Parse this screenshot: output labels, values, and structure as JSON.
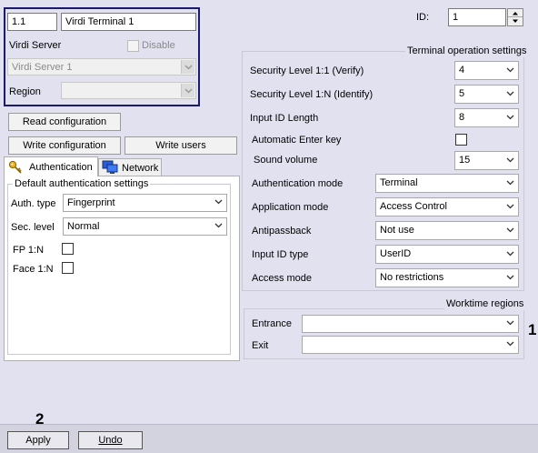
{
  "server_panel": {
    "terminal_id": "1.1",
    "terminal_name": "Virdi Terminal 1",
    "server_label": "Virdi Server",
    "disable_label": "Disable",
    "server_value": "Virdi Server 1",
    "region_label": "Region",
    "region_value": ""
  },
  "buttons": {
    "read_config": "Read configuration",
    "write_config": "Write configuration",
    "write_users": "Write users",
    "apply": "Apply",
    "undo": "Undo"
  },
  "tabs": [
    {
      "label": "Authentication",
      "icon": "key-icon",
      "active": true
    },
    {
      "label": "Network",
      "icon": "network-icon",
      "active": false
    }
  ],
  "auth_settings": {
    "group_title": "Default authentication settings",
    "auth_type_label": "Auth. type",
    "auth_type_value": "Fingerprint",
    "sec_level_label": "Sec. level",
    "sec_level_value": "Normal",
    "fp_label": "FP 1:N",
    "face_label": "Face 1:N"
  },
  "id_field": {
    "label": "ID:",
    "value": "1"
  },
  "terminal_settings": {
    "title": "Terminal operation settings",
    "rows": [
      {
        "label": "Security Level 1:1 (Verify)",
        "value": "4"
      },
      {
        "label": "Security Level 1:N (Identify)",
        "value": "5"
      },
      {
        "label": "Input ID Length",
        "value": "8"
      },
      {
        "label": "Automatic Enter key",
        "value": ""
      },
      {
        "label": "Sound volume",
        "value": "15"
      },
      {
        "label": "Authentication mode",
        "value": "Terminal"
      },
      {
        "label": "Application mode",
        "value": "Access Control"
      },
      {
        "label": "Antipassback",
        "value": "Not use"
      },
      {
        "label": "Input ID type",
        "value": "UserID"
      },
      {
        "label": "Access mode",
        "value": "No restrictions"
      }
    ]
  },
  "worktime": {
    "title": "Worktime regions",
    "entrance_label": "Entrance",
    "entrance_value": "",
    "exit_label": "Exit",
    "exit_value": ""
  },
  "markers": {
    "marker_1": "1",
    "marker_2": "2"
  }
}
